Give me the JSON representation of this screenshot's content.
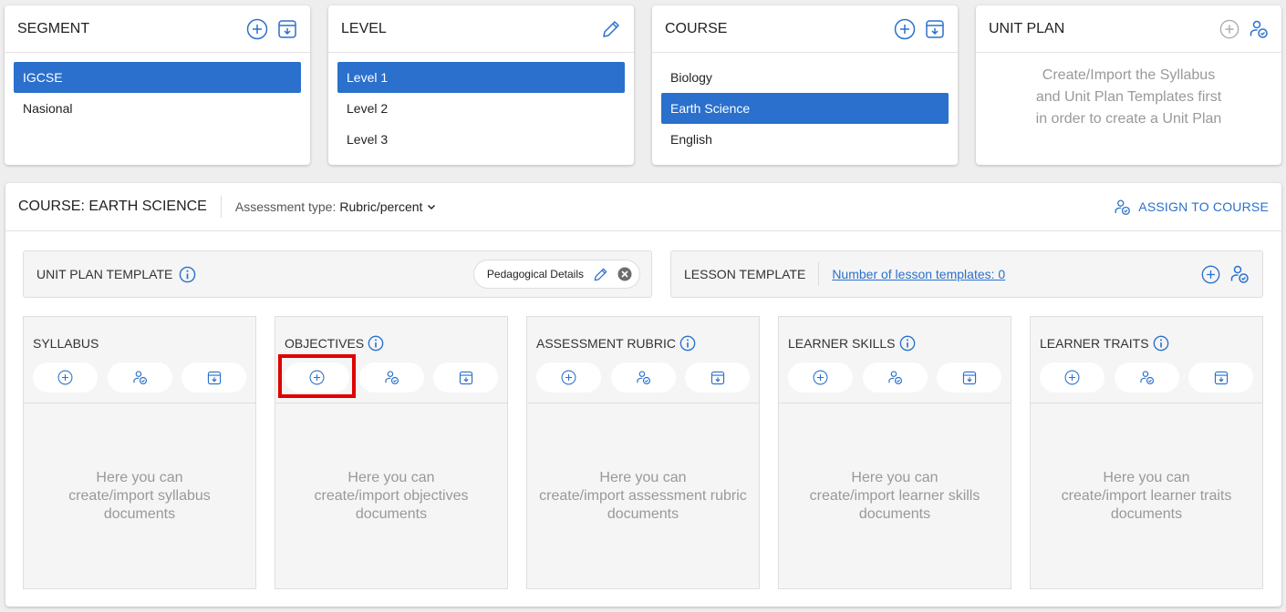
{
  "segment": {
    "title": "SEGMENT",
    "items": [
      "IGCSE",
      "Nasional"
    ]
  },
  "level": {
    "title": "LEVEL",
    "items": [
      "Level 1",
      "Level 2",
      "Level 3"
    ]
  },
  "course": {
    "title": "COURSE",
    "items": [
      "Biology",
      "Earth Science",
      "English"
    ]
  },
  "unit_plan": {
    "title": "UNIT PLAN",
    "message_lines": [
      "Create/Import the Syllabus",
      "and Unit Plan Templates first",
      "in order to create a Unit Plan"
    ]
  },
  "main": {
    "course_label": "COURSE: EARTH SCIENCE",
    "assessment_label": "Assessment type:",
    "assessment_value": "Rubric/percent",
    "assign_label": "ASSIGN TO COURSE"
  },
  "unit_plan_template": {
    "title": "UNIT PLAN TEMPLATE",
    "chip": "Pedagogical Details"
  },
  "lesson_template": {
    "title": "LESSON TEMPLATE",
    "link": "Number of lesson templates: 0"
  },
  "cards": [
    {
      "title": "SYLLABUS",
      "info": false,
      "msg": [
        "Here you can",
        "create/import syllabus",
        "documents"
      ]
    },
    {
      "title": "OBJECTIVES",
      "info": true,
      "msg": [
        "Here you can",
        "create/import objectives",
        "documents"
      ]
    },
    {
      "title": "ASSESSMENT RUBRIC",
      "info": true,
      "msg": [
        "Here you can",
        "create/import assessment rubric",
        "documents"
      ]
    },
    {
      "title": "LEARNER SKILLS",
      "info": true,
      "msg": [
        "Here you can",
        "create/import learner skills",
        "documents"
      ]
    },
    {
      "title": "LEARNER TRAITS",
      "info": true,
      "msg": [
        "Here you can",
        "create/import learner traits",
        "documents"
      ]
    }
  ],
  "colors": {
    "accent": "#2a70cc",
    "highlight": "#e00000"
  }
}
